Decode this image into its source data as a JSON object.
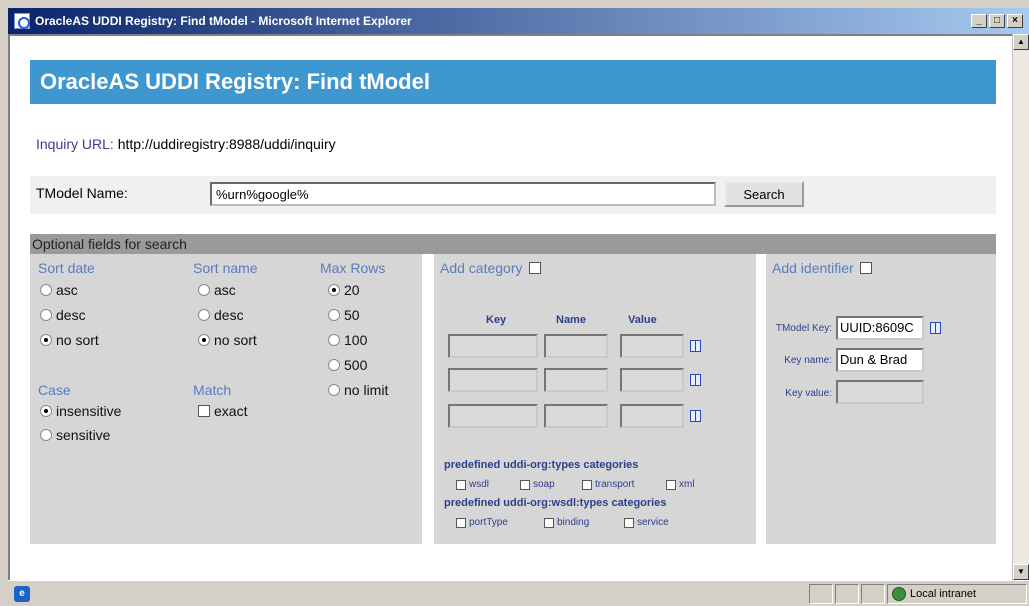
{
  "window": {
    "title": "OracleAS UDDI Registry: Find tModel - Microsoft Internet Explorer",
    "min": "_",
    "max": "□",
    "close": "×"
  },
  "page": {
    "heading": "OracleAS UDDI Registry: Find tModel",
    "inquiry_label": "Inquiry URL:",
    "inquiry_url": "http://uddiregistry:8988/uddi/inquiry",
    "tmodel_name_label": "TModel Name:",
    "tmodel_name_value": "%urn%google%",
    "search_button": "Search",
    "optional_header": "Optional fields for search"
  },
  "sort_date": {
    "title": "Sort date",
    "options": [
      "asc",
      "desc",
      "no sort"
    ],
    "selected": "no sort"
  },
  "sort_name": {
    "title": "Sort name",
    "options": [
      "asc",
      "desc",
      "no sort"
    ],
    "selected": "no sort"
  },
  "max_rows": {
    "title": "Max Rows",
    "options": [
      "20",
      "50",
      "100",
      "500",
      "no limit"
    ],
    "selected": "20"
  },
  "case": {
    "title": "Case",
    "options": [
      "insensitive",
      "sensitive"
    ],
    "selected": "insensitive"
  },
  "match": {
    "title": "Match",
    "option": "exact"
  },
  "category": {
    "title": "Add category",
    "columns": [
      "Key",
      "Name",
      "Value"
    ],
    "predef_types_title": "predefined uddi-org:types categories",
    "types": [
      "wsdl",
      "soap",
      "transport",
      "xml"
    ],
    "predef_wsdl_title": "predefined uddi-org:wsdl:types categories",
    "wsdl_types": [
      "portType",
      "binding",
      "service"
    ]
  },
  "identifier": {
    "title": "Add identifier",
    "tmodel_key_label": "TModel Key:",
    "tmodel_key_value": "UUID:8609C",
    "key_name_label": "Key name:",
    "key_name_value": "Dun & Brad",
    "key_value_label": "Key value:",
    "key_value_value": ""
  },
  "status": {
    "zone": "Local intranet"
  }
}
